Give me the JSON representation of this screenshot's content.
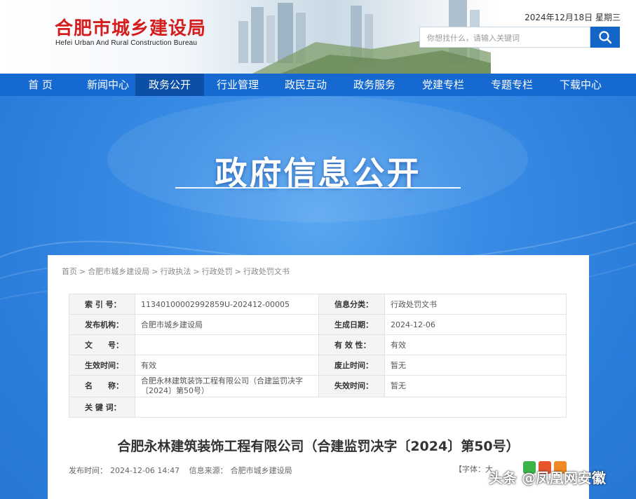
{
  "header": {
    "logo_cn": "合肥市城乡建设局",
    "logo_en": "Hefei Urban And Rural Construction Bureau",
    "date": "2024年12月18日 星期三",
    "search_placeholder": "你想找什么，请输入关键词",
    "search_icon": "search-icon"
  },
  "nav": {
    "items": [
      {
        "label": "首 页"
      },
      {
        "label": "新闻中心"
      },
      {
        "label": "政务公开"
      },
      {
        "label": "行业管理"
      },
      {
        "label": "政民互动"
      },
      {
        "label": "政务服务"
      },
      {
        "label": "党建专栏"
      },
      {
        "label": "专题专栏"
      },
      {
        "label": "下载中心"
      }
    ],
    "active_index": 2
  },
  "banner": {
    "title": "政府信息公开"
  },
  "breadcrumb": [
    "首页",
    "合肥市城乡建设局",
    "行政执法",
    "行政处罚",
    "行政处罚文书"
  ],
  "breadcrumb_sep": ">",
  "meta": {
    "rows": [
      {
        "k1": "索 引 号：",
        "v1": "11340100002992859U-202412-00005",
        "k2": "信息分类：",
        "v2": "行政处罚文书"
      },
      {
        "k1": "发布机构：",
        "v1": "合肥市城乡建设局",
        "k2": "生成日期：",
        "v2": "2024-12-06"
      },
      {
        "k1": "文　　号：",
        "v1": "",
        "k2": "有 效 性：",
        "v2": "有效"
      },
      {
        "k1": "生效时间：",
        "v1": "有效",
        "k2": "废止时间：",
        "v2": "暂无"
      },
      {
        "k1": "名　　称：",
        "v1": "合肥永林建筑装饰工程有限公司（合建监罚决字〔2024〕第50号）",
        "k2": "失效时间：",
        "v2": "暂无"
      },
      {
        "k1": "关 键 词：",
        "v1": ""
      }
    ]
  },
  "article": {
    "title": "合肥永林建筑装饰工程有限公司（合建监罚决字〔2024〕第50号）",
    "publish_label": "发布时间：",
    "publish_time": "2024-12-06 14:47",
    "source_label": "信息来源：",
    "source": "合肥市城乡建设局",
    "font_label": "【字体：",
    "font_size_big": "大"
  },
  "colors": {
    "brand_red": "#d41e1e",
    "nav_blue": "#1569d1",
    "nav_active": "#0b4fa6",
    "banner_blue": "#2c7edb"
  },
  "watermark": "头条 @凤凰网安徽"
}
